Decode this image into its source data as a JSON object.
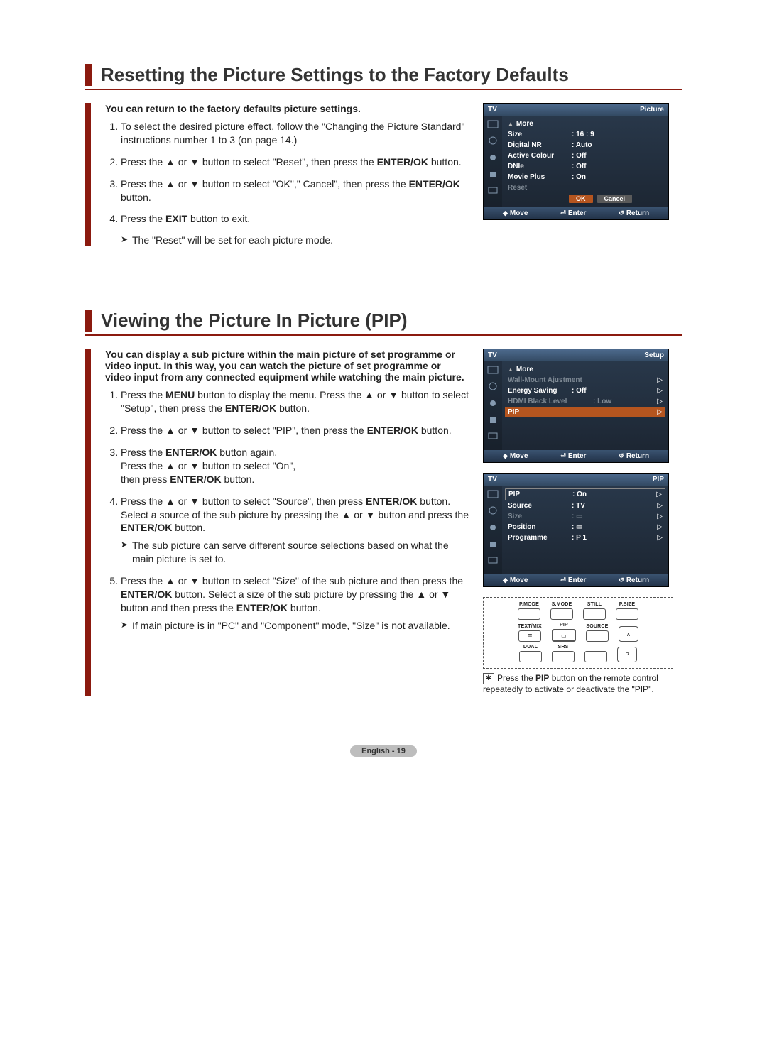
{
  "section1": {
    "title": "Resetting the Picture Settings to the Factory Defaults",
    "intro": "You can return to the factory defaults picture settings.",
    "steps": [
      "To select the desired picture effect, follow the \"Changing the Picture Standard\" instructions number 1 to 3 (on page 14.)",
      "Press the ▲ or ▼ button to select \"Reset\", then press the ENTER/OK button.",
      "Press the ▲ or ▼ button to select \"OK\",\" Cancel\", then press the ENTER/OK button.",
      "Press the EXIT button to exit."
    ],
    "note": "The \"Reset\" will be set for each picture mode."
  },
  "osd1": {
    "headerLeft": "TV",
    "headerRight": "Picture",
    "more": "More",
    "rows": [
      {
        "label": "Size",
        "value": ": 16 : 9"
      },
      {
        "label": "Digital NR",
        "value": ": Auto"
      },
      {
        "label": "Active Colour",
        "value": ": Off"
      },
      {
        "label": "DNIe",
        "value": ": Off"
      },
      {
        "label": "Movie Plus",
        "value": ": On"
      },
      {
        "label": "Reset",
        "value": ""
      }
    ],
    "pills": [
      "OK",
      "Cancel"
    ],
    "footer": {
      "move": "Move",
      "enter": "Enter",
      "ret": "Return"
    }
  },
  "section2": {
    "title": "Viewing the Picture In Picture (PIP)",
    "intro": "You can display a sub picture within the main picture of set programme or video input. In this way, you can watch the picture of set programme or video input from any connected equipment while watching the main picture.",
    "steps": [
      {
        "t": "Press the MENU button to display the menu. Press the ▲ or ▼ button to select \"Setup\", then press the ENTER/OK button."
      },
      {
        "t": "Press the ▲ or ▼ button to select \"PIP\", then press the ENTER/OK button."
      },
      {
        "t": "Press the ENTER/OK button again. Press the ▲ or ▼ button to select \"On\", then press ENTER/OK button."
      },
      {
        "t": "Press the ▲ or ▼ button to select \"Source\", then press ENTER/OK button. Select a source of the sub picture by pressing the ▲ or ▼ button and press the ENTER/OK button.",
        "note": "The sub picture can serve different source selections based on what the main picture is set to."
      },
      {
        "t": "Press the ▲ or ▼ button to select \"Size\" of the sub picture and then press the ENTER/OK button. Select a size of the sub picture by pressing the ▲ or ▼ button and then press the ENTER/OK button.",
        "note": "If main picture is in \"PC\" and \"Component\" mode, \"Size\" is not available."
      }
    ]
  },
  "osd2": {
    "headerLeft": "TV",
    "headerRight": "Setup",
    "more": "More",
    "rows": [
      {
        "label": "Wall-Mount Ajustment",
        "value": "",
        "dim": true,
        "chev": true
      },
      {
        "label": "Energy Saving",
        "value": ": Off",
        "chev": true
      },
      {
        "label": "HDMI Black Level",
        "value": ": Low",
        "dim": true,
        "chev": true
      },
      {
        "label": "PIP",
        "value": "",
        "hl": true,
        "chev": true
      }
    ],
    "footer": {
      "move": "Move",
      "enter": "Enter",
      "ret": "Return"
    }
  },
  "osd3": {
    "headerLeft": "TV",
    "headerRight": "PIP",
    "rows": [
      {
        "label": "PIP",
        "value": ": On",
        "box": true,
        "chev": true
      },
      {
        "label": "Source",
        "value": ": TV",
        "chev": true
      },
      {
        "label": "Size",
        "value": ": ▭",
        "dim": true,
        "chev": true
      },
      {
        "label": "Position",
        "value": ": ▭",
        "chev": true
      },
      {
        "label": "Programme",
        "value": ": P 1",
        "chev": true
      }
    ],
    "footer": {
      "move": "Move",
      "enter": "Enter",
      "ret": "Return"
    }
  },
  "remote": {
    "row1": [
      "P.MODE",
      "S.MODE",
      "STILL",
      "P.SIZE"
    ],
    "row2": [
      "TEXT/MIX",
      "PIP",
      "SOURCE"
    ],
    "row3": [
      "DUAL",
      "SRS"
    ],
    "up": "∧",
    "p": "P"
  },
  "tip": "Press the PIP button on the remote control repeatedly to activate or deactivate the \"PIP\".",
  "footer": "English - 19"
}
